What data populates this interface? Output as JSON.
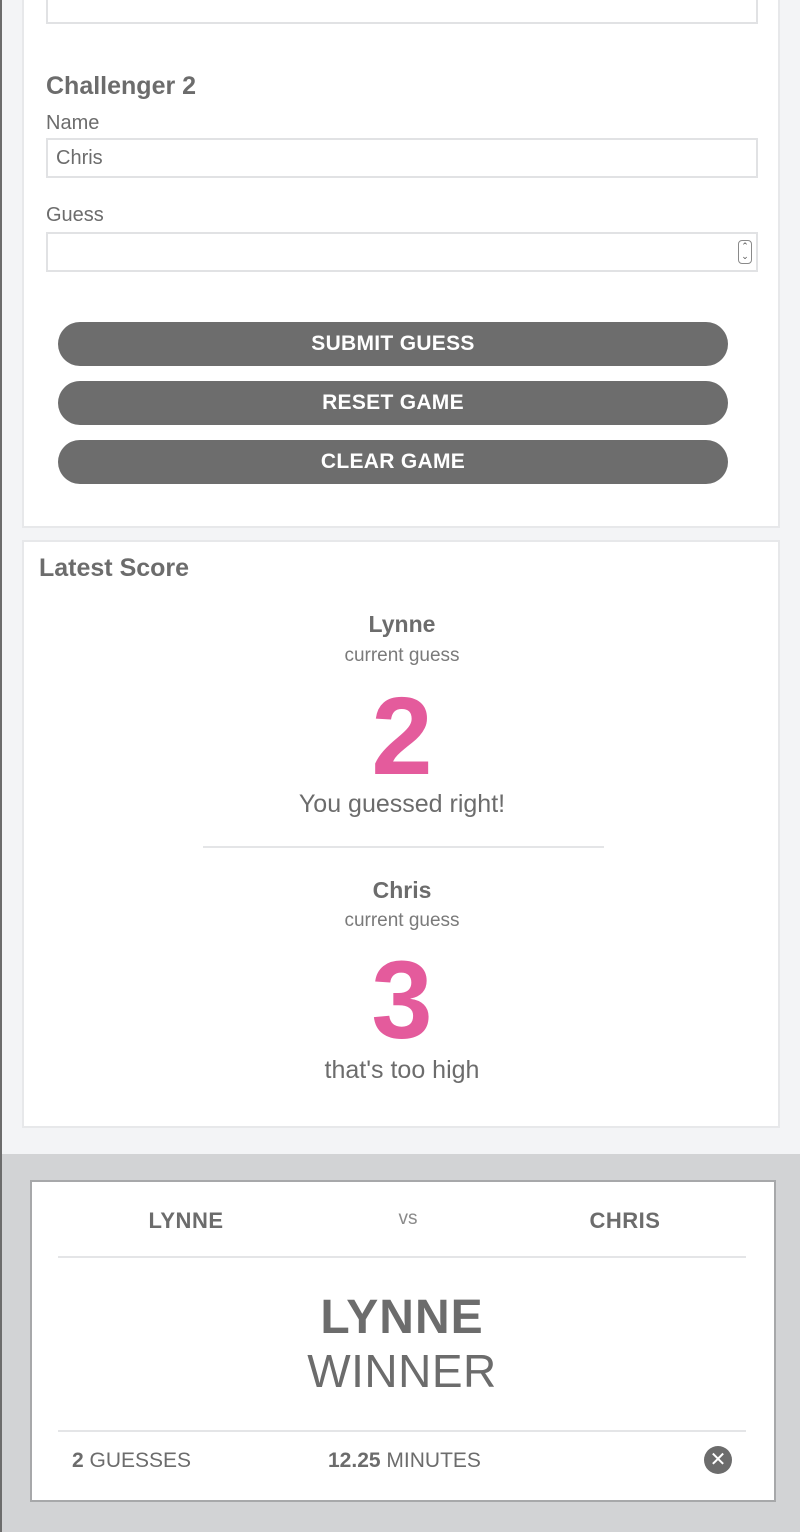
{
  "form": {
    "challenger_title": "Challenger 2",
    "name_label": "Name",
    "name_value": "Chris",
    "guess_label": "Guess",
    "guess_value": "",
    "submit_label": "SUBMIT GUESS",
    "reset_label": "RESET GAME",
    "clear_label": "CLEAR GAME"
  },
  "score": {
    "title": "Latest Score",
    "players": [
      {
        "name": "Lynne",
        "sub": "current guess",
        "guess": "2",
        "message": "You guessed right!"
      },
      {
        "name": "Chris",
        "sub": "current guess",
        "guess": "3",
        "message": "that's too high"
      }
    ]
  },
  "result": {
    "player1": "LYNNE",
    "vs": "vs",
    "player2": "CHRIS",
    "winner_name": "LYNNE",
    "winner_label": "WINNER",
    "guesses_count": "2",
    "guesses_label": "GUESSES",
    "minutes_value": "12.25",
    "minutes_label": "MINUTES",
    "close_glyph": "✕"
  },
  "colors": {
    "accent_pink": "#e45b9c",
    "button_gray": "#6d6d6d",
    "text_gray": "#6c6c6c"
  }
}
